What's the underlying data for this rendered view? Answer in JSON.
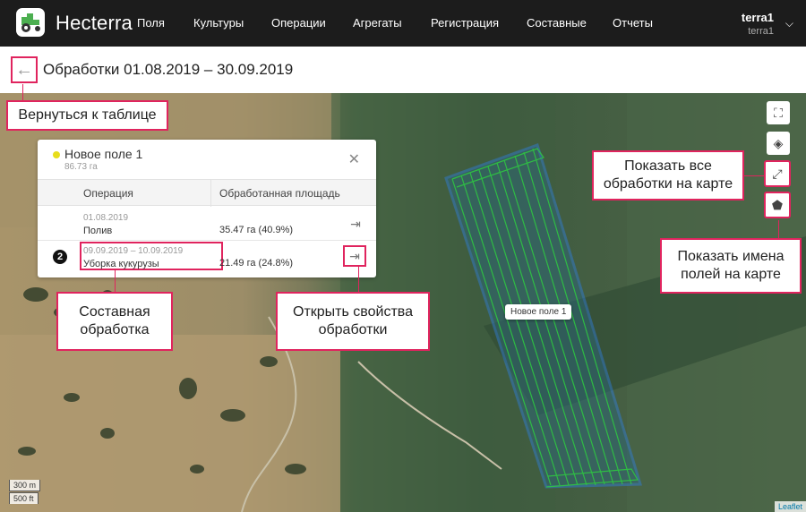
{
  "app": {
    "brand": "Hecterra"
  },
  "nav": [
    "Поля",
    "Культуры",
    "Операции",
    "Агрегаты",
    "Регистрация",
    "Составные",
    "Отчеты"
  ],
  "user": {
    "name": "terra1",
    "sub": "terra1"
  },
  "page": {
    "title": "Обработки 01.08.2019 – 30.09.2019"
  },
  "popup": {
    "field_name": "Новое поле 1",
    "field_area": "86.73 га",
    "dot_color": "#e7dd1b",
    "headers": {
      "operation": "Операция",
      "area": "Обработанная площадь"
    },
    "rows": [
      {
        "date": "01.08.2019",
        "operation": "Полив",
        "area": "35.47 га (40.9%)",
        "badge": ""
      },
      {
        "date": "09.09.2019 – 10.09.2019",
        "operation": "Уборка кукурузы",
        "area": "21.49 га (24.8%)",
        "badge": "2"
      }
    ]
  },
  "map": {
    "field_label": "Новое поле 1",
    "scale_metric": "300 m",
    "scale_imperial": "500 ft",
    "attribution": "Leaflet",
    "controls": [
      "fullscreen-icon",
      "layers-icon",
      "expand-icon",
      "tag-icon"
    ]
  },
  "callouts": {
    "back": "Вернуться к таблице",
    "composite": "Составная обработка",
    "open_props": "Открыть свойства обработки",
    "show_all": "Показать все обработки на карте",
    "show_names": "Показать имена полей на карте"
  },
  "colors": {
    "accent": "#e0245e",
    "topbar": "#1c1c1c",
    "field_outline": "#2f7fe0",
    "track": "#2ecc40"
  }
}
